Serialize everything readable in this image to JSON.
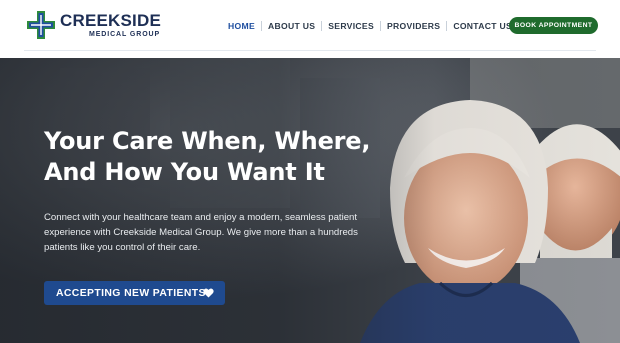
{
  "brand": {
    "name": "CREEKSIDE",
    "subtitle": "MEDICAL GROUP",
    "colors": {
      "navy": "#1e2f55",
      "green": "#2e8b3c",
      "blue": "#1f4fa0"
    }
  },
  "nav": {
    "items": [
      {
        "label": "HOME",
        "active": true
      },
      {
        "label": "ABOUT US",
        "active": false
      },
      {
        "label": "SERVICES",
        "active": false
      },
      {
        "label": "PROVIDERS",
        "active": false
      },
      {
        "label": "CONTACT US",
        "active": false
      }
    ],
    "book_label": "BOOK APPOINTMENT"
  },
  "hero": {
    "title_line1": "Your Care When, Where,",
    "title_line2": "And How You Want It",
    "body": "Connect with your healthcare team and enjoy a modern, seamless patient experience with Creekside Medical Group. We give more than a hundreds patients like you control of their care.",
    "cta_label": "ACCEPTING NEW PATIENTS",
    "cta_icon": "heart-icon"
  }
}
